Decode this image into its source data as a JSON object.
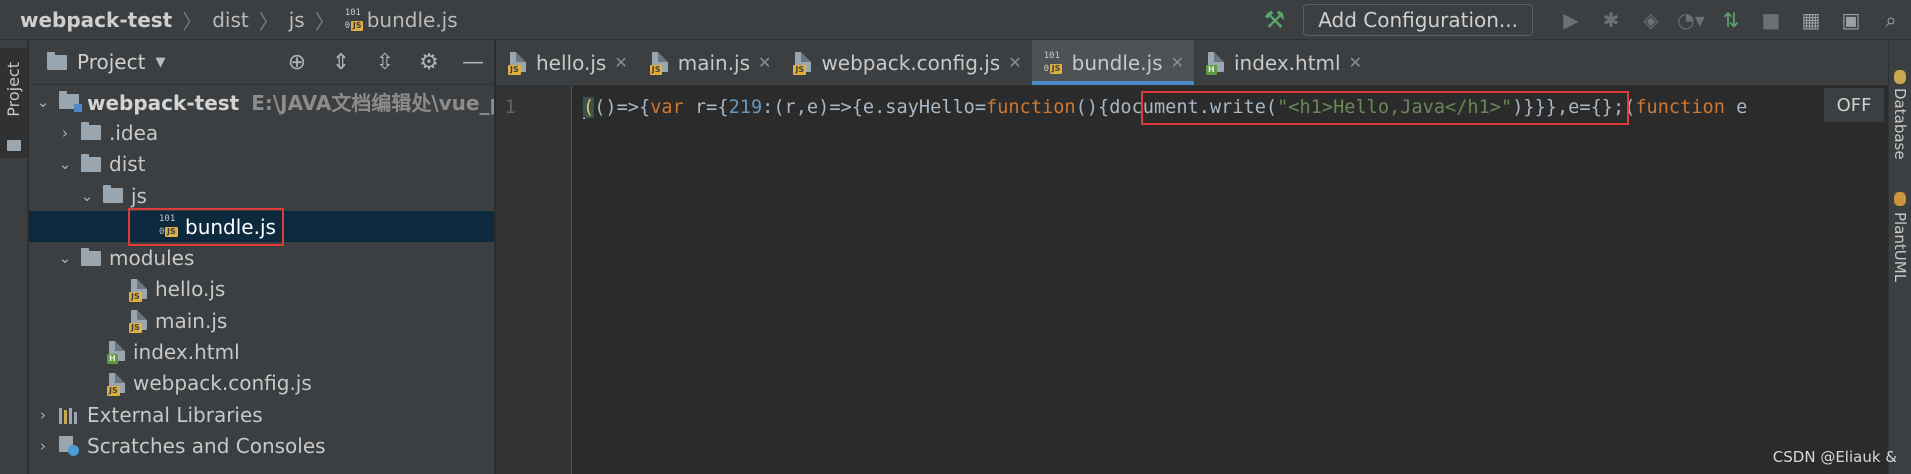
{
  "navbar": {
    "project": "webpack-test",
    "crumb1": "dist",
    "crumb2": "js",
    "file": "bundle.js",
    "file_icon_text": "101",
    "file_icon_tag": "JS",
    "add_config_label": "Add Configuration..."
  },
  "left_strip": {
    "project_tab": "Project"
  },
  "project_panel": {
    "title": "Project",
    "tree": [
      {
        "label": "webpack-test",
        "note": "E:\\JAVA文档编辑处\\vue_pro"
      },
      {
        "label": ".idea"
      },
      {
        "label": "dist"
      },
      {
        "label": "js"
      },
      {
        "label": "bundle.js"
      },
      {
        "label": "modules"
      },
      {
        "label": "hello.js"
      },
      {
        "label": "main.js"
      },
      {
        "label": "index.html"
      },
      {
        "label": "webpack.config.js"
      },
      {
        "label": "External Libraries"
      },
      {
        "label": "Scratches and Consoles"
      }
    ],
    "icon_tags": {
      "js": "JS",
      "html": "H",
      "binary_num": "101",
      "binary_zero": "0"
    }
  },
  "tabs": [
    {
      "label": "hello.js"
    },
    {
      "label": "main.js"
    },
    {
      "label": "webpack.config.js"
    },
    {
      "label": "bundle.js"
    },
    {
      "label": "index.html"
    }
  ],
  "editor": {
    "line_number": "1",
    "off_badge": "OFF"
  },
  "right_strip": {
    "database_tab": "Database",
    "plantuml_tab": "PlantUML"
  },
  "watermark": "CSDN @Eliauk &"
}
